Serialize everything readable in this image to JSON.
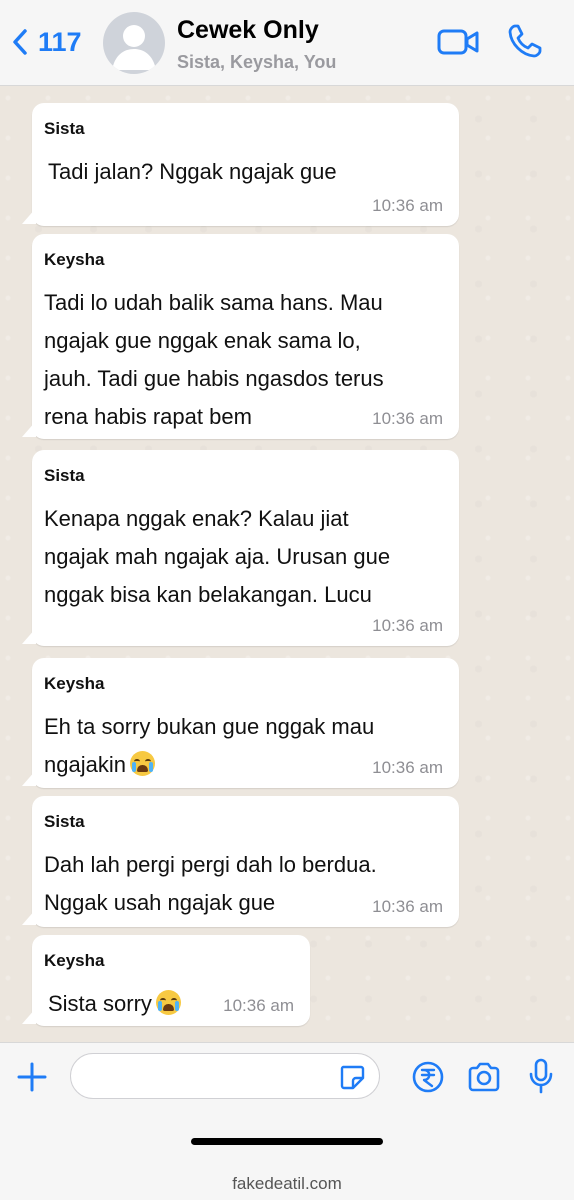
{
  "header": {
    "back_count": "117",
    "title": "Cewek Only",
    "subtitle": "Sista, Keysha, You",
    "icons": {
      "back": "chevron-left-icon",
      "video": "video-camera-icon",
      "phone": "phone-icon",
      "avatar": "group-avatar"
    },
    "accent_color": "#1f7cf6"
  },
  "messages": [
    {
      "sender": "Sista",
      "text": "Tadi jalan? Nggak ngajak gue",
      "time": "10:36 am"
    },
    {
      "sender": "Keysha",
      "text": "Tadi lo udah balik sama hans. Mau\nngajak gue nggak enak sama lo,\njauh. Tadi gue habis ngasdos terus\nrena habis rapat bem",
      "time": "10:36 am"
    },
    {
      "sender": "Sista",
      "text": "Kenapa nggak enak? Kalau jiat\nngajak mah ngajak aja. Urusan gue\nnggak bisa kan belakangan. Lucu",
      "time": "10:36 am"
    },
    {
      "sender": "Keysha",
      "text": "Eh ta sorry bukan gue nggak mau\nngajakin",
      "emoji": "loudly-crying-face",
      "time": "10:36 am"
    },
    {
      "sender": "Sista",
      "text": "Dah lah pergi pergi dah lo berdua.\nNggak usah ngajak gue",
      "time": "10:36 am"
    },
    {
      "sender": "Keysha",
      "text": "Sista sorry",
      "emoji": "loudly-crying-face",
      "time": "10:36 am"
    }
  ],
  "input": {
    "placeholder": "",
    "icons": [
      "plus-icon",
      "sticker-icon",
      "rupee-icon",
      "camera-icon",
      "microphone-icon"
    ]
  },
  "footer": {
    "watermark": "fakedeatil.com"
  }
}
